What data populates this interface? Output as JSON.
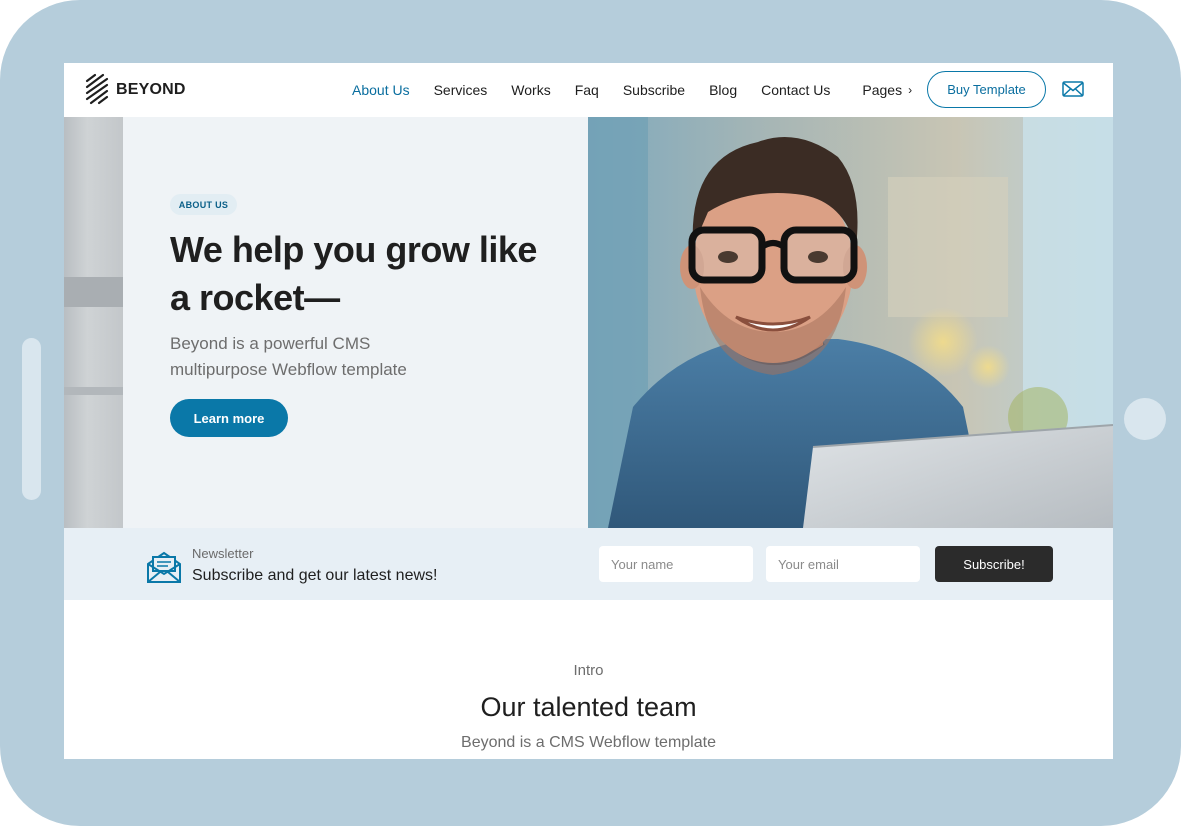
{
  "nav": {
    "logo_text": "BEYOND",
    "links": [
      "About Us",
      "Services",
      "Works",
      "Faq",
      "Subscribe",
      "Blog",
      "Contact Us"
    ],
    "pages_label": "Pages",
    "buy_label": "Buy Template"
  },
  "hero": {
    "badge": "ABOUT US",
    "title_line1": "We help you grow like",
    "title_line2": "a rocket—",
    "subtitle_line1": "Beyond is a powerful CMS",
    "subtitle_line2": "multipurpose Webflow template",
    "cta_label": "Learn more"
  },
  "newsletter": {
    "kicker": "Newsletter",
    "headline": "Subscribe and get our latest news!",
    "name_placeholder": "Your name",
    "email_placeholder": "Your email",
    "button_label": "Subscribe!"
  },
  "intro": {
    "label": "Intro",
    "title": "Our talented team",
    "subtitle": "Beyond is a CMS Webflow template"
  },
  "colors": {
    "accent": "#0a78a8",
    "frame": "#b5cddb",
    "hero_bg": "#eff3f6",
    "newsletter_bg": "#e7eff5",
    "dark_button": "#2b2b2b"
  }
}
